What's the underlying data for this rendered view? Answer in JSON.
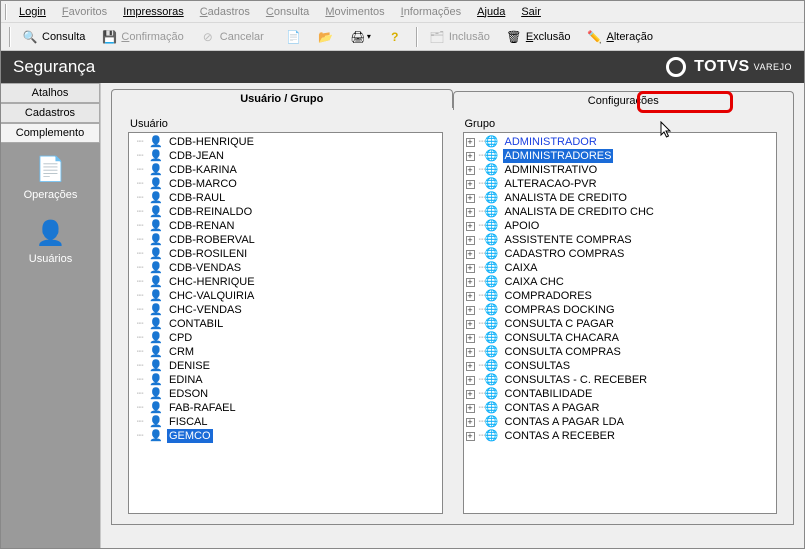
{
  "menu": {
    "items": [
      {
        "label": "Login",
        "enabled": true
      },
      {
        "label": "Favoritos",
        "enabled": false
      },
      {
        "label": "Impressoras",
        "enabled": true
      },
      {
        "label": "Cadastros",
        "enabled": false
      },
      {
        "label": "Consulta",
        "enabled": false
      },
      {
        "label": "Movimentos",
        "enabled": false
      },
      {
        "label": "Informações",
        "enabled": false
      },
      {
        "label": "Ajuda",
        "enabled": true
      },
      {
        "label": "Sair",
        "enabled": true
      }
    ]
  },
  "toolbar": {
    "consulta": "Consulta",
    "confirmacao": "Confirmação",
    "cancelar": "Cancelar",
    "inclusao": "Inclusão",
    "exclusao": "Exclusão",
    "alteracao": "Alteração"
  },
  "header": {
    "title": "Segurança",
    "brand_main": "TOTVS",
    "brand_sub": "VAREJO"
  },
  "sidebar": {
    "tabs": [
      "Atalhos",
      "Cadastros",
      "Complemento"
    ],
    "items": [
      {
        "label": "Operações",
        "icon": "📄"
      },
      {
        "label": "Usuários",
        "icon": "👤"
      }
    ]
  },
  "content": {
    "tabs": {
      "main": "Usuário  / Grupo",
      "config": "Configurações"
    },
    "usuario_label": "Usuário",
    "grupo_label": "Grupo",
    "usuarios": [
      "CDB-HENRIQUE",
      "CDB-JEAN",
      "CDB-KARINA",
      "CDB-MARCO",
      "CDB-RAUL",
      "CDB-REINALDO",
      "CDB-RENAN",
      "CDB-ROBERVAL",
      "CDB-ROSILENI",
      "CDB-VENDAS",
      "CHC-HENRIQUE",
      "CHC-VALQUIRIA",
      "CHC-VENDAS",
      "CONTABIL",
      "CPD",
      "CRM",
      "DENISE",
      "EDINA",
      "EDSON",
      "FAB-RAFAEL",
      "FISCAL",
      "GEMCO"
    ],
    "usuario_selected_index": 21,
    "grupos": [
      "ADMINISTRADOR",
      "ADMINISTRADORES",
      "ADMINISTRATIVO",
      "ALTERACAO-PVR",
      "ANALISTA DE CREDITO",
      "ANALISTA DE CREDITO CHC",
      "APOIO",
      "ASSISTENTE COMPRAS",
      "CADASTRO COMPRAS",
      "CAIXA",
      "CAIXA CHC",
      "COMPRADORES",
      "COMPRAS DOCKING",
      "CONSULTA C PAGAR",
      "CONSULTA CHACARA",
      "CONSULTA COMPRAS",
      "CONSULTAS",
      "CONSULTAS - C. RECEBER",
      "CONTABILIDADE",
      "CONTAS A PAGAR",
      "CONTAS A PAGAR LDA",
      "CONTAS A RECEBER"
    ],
    "grupo_linked_index": 0,
    "grupo_selected_index": 1
  }
}
